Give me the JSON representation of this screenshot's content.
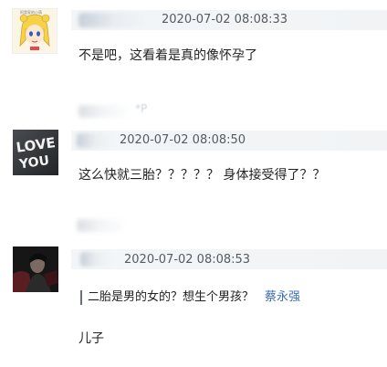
{
  "comments": [
    {
      "timestamp": "2020-07-02 08:08:33",
      "text": "不是吧，这看着是真的像怀孕了",
      "avatar_icon": "sailor-moon-avatar-icon"
    },
    {
      "timestamp": "2020-07-02 08:08:50",
      "text": "这么快就三胎？？？？？ 身体接受得了？？",
      "avatar_icon": "love-you-avatar-icon",
      "avatar_text": [
        "LOVE",
        "YOU"
      ]
    },
    {
      "timestamp": "2020-07-02 08:08:53",
      "quote_text": "二胎是男的女的？想生个男孩？",
      "quote_author": "蔡永强",
      "text": "儿子",
      "avatar_icon": "dark-portrait-avatar-icon"
    }
  ],
  "colors": {
    "header_bg": "#f2f4f6",
    "author_link": "#3b6fb6",
    "timestamp": "#555b63"
  }
}
